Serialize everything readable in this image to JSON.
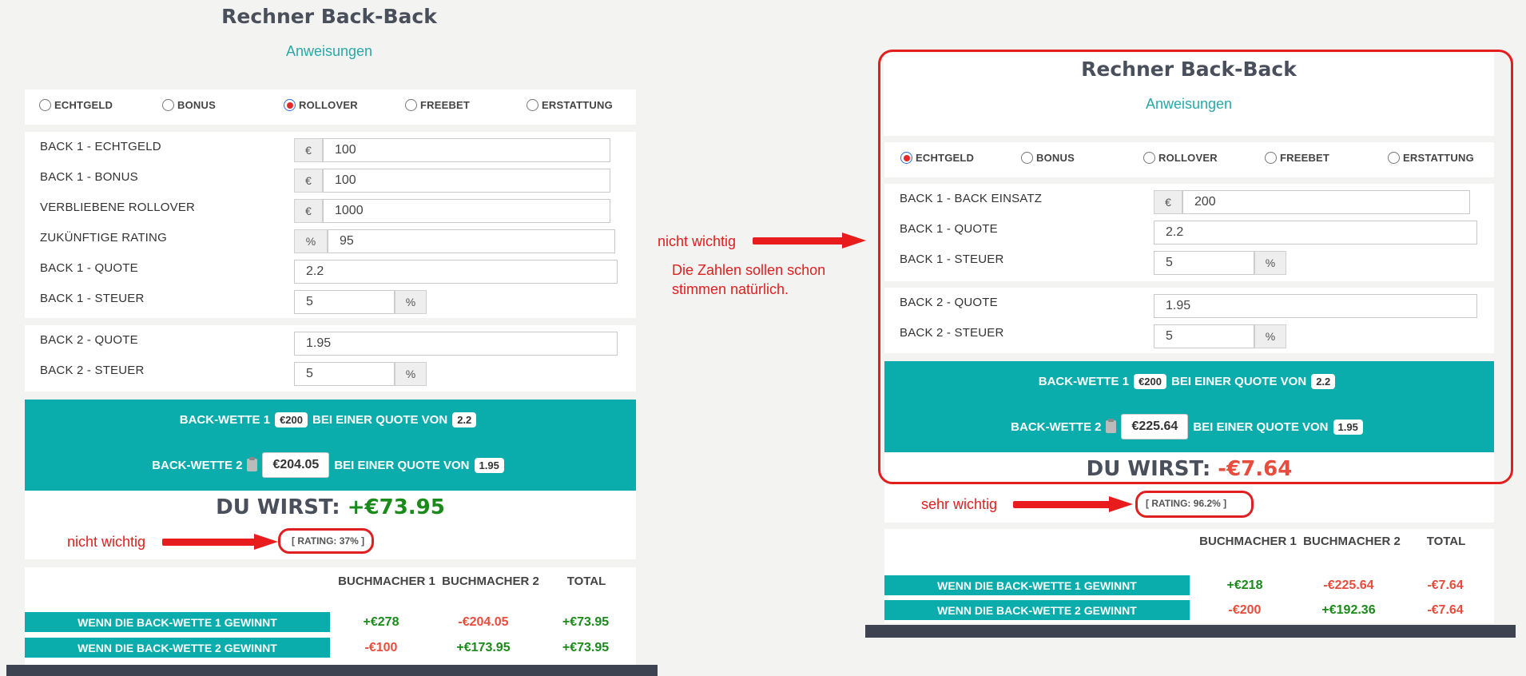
{
  "left": {
    "title": "Rechner Back-Back",
    "instructions_link": "Anweisungen",
    "radios": [
      {
        "label": "ECHTGELD",
        "checked": false
      },
      {
        "label": "BONUS",
        "checked": false
      },
      {
        "label": "ROLLOVER",
        "checked": true
      },
      {
        "label": "FREEBET",
        "checked": false
      },
      {
        "label": "ERSTATTUNG",
        "checked": false
      }
    ],
    "fields1": [
      {
        "label": "BACK 1 - ECHTGELD",
        "prefix": "€",
        "value": "100"
      },
      {
        "label": "BACK 1 - BONUS",
        "prefix": "€",
        "value": "100"
      },
      {
        "label": "VERBLIEBENE ROLLOVER",
        "prefix": "€",
        "value": "1000"
      },
      {
        "label": "ZUKÜNFTIGE RATING",
        "prefix": "%",
        "value": "95"
      },
      {
        "label": "BACK 1 - QUOTE",
        "value": "2.2"
      },
      {
        "label": "BACK 1 - STEUER",
        "value": "5",
        "suffix": "%"
      }
    ],
    "fields2": [
      {
        "label": "BACK 2 - QUOTE",
        "value": "1.95"
      },
      {
        "label": "BACK 2 - STEUER",
        "value": "5",
        "suffix": "%"
      }
    ],
    "bet1": {
      "prefix": "BACK-WETTE 1",
      "amount": "€200",
      "mid": "BEI EINER QUOTE VON",
      "odds": "2.2"
    },
    "bet2": {
      "prefix": "BACK-WETTE 2",
      "amount": "€204.05",
      "mid": "BEI EINER QUOTE VON",
      "odds": "1.95"
    },
    "result_label": "DU WIRST:",
    "result_value": "+€73.95",
    "rating": "[ RATING: 37% ]",
    "annotation": "nicht wichtig",
    "table": {
      "headers": [
        "BUCHMACHER 1",
        "BUCHMACHER 2",
        "TOTAL"
      ],
      "rows": [
        {
          "label": "WENN DIE BACK-WETTE 1 GEWINNT",
          "values": [
            "+€278",
            "-€204.05",
            "+€73.95"
          ]
        },
        {
          "label": "WENN DIE BACK-WETTE 2 GEWINNT",
          "values": [
            "-€100",
            "+€173.95",
            "+€73.95"
          ]
        }
      ]
    }
  },
  "middle": {
    "annotation": "nicht wichtig",
    "note_line1": "Die Zahlen sollen schon",
    "note_line2": "stimmen natürlich."
  },
  "right": {
    "title": "Rechner Back-Back",
    "instructions_link": "Anweisungen",
    "radios": [
      {
        "label": "ECHTGELD",
        "checked": true
      },
      {
        "label": "BONUS",
        "checked": false
      },
      {
        "label": "ROLLOVER",
        "checked": false
      },
      {
        "label": "FREEBET",
        "checked": false
      },
      {
        "label": "ERSTATTUNG",
        "checked": false
      }
    ],
    "fields1": [
      {
        "label": "BACK 1 - BACK EINSATZ",
        "prefix": "€",
        "value": "200"
      },
      {
        "label": "BACK 1 - QUOTE",
        "value": "2.2"
      },
      {
        "label": "BACK 1 - STEUER",
        "value": "5",
        "suffix": "%"
      }
    ],
    "fields2": [
      {
        "label": "BACK 2 - QUOTE",
        "value": "1.95"
      },
      {
        "label": "BACK 2 - STEUER",
        "value": "5",
        "suffix": "%"
      }
    ],
    "bet1": {
      "prefix": "BACK-WETTE 1",
      "amount": "€200",
      "mid": "BEI EINER QUOTE VON",
      "odds": "2.2"
    },
    "bet2": {
      "prefix": "BACK-WETTE 2",
      "amount": "€225.64",
      "mid": "BEI EINER QUOTE VON",
      "odds": "1.95"
    },
    "result_label": "DU WIRST:",
    "result_value": "-€7.64",
    "rating": "[ RATING: 96.2% ]",
    "annotation": "sehr wichtig",
    "table": {
      "headers": [
        "BUCHMACHER 1",
        "BUCHMACHER 2",
        "TOTAL"
      ],
      "rows": [
        {
          "label": "WENN DIE BACK-WETTE 1 GEWINNT",
          "values": [
            "+€218",
            "-€225.64",
            "-€7.64"
          ]
        },
        {
          "label": "WENN DIE BACK-WETTE 2 GEWINNT",
          "values": [
            "-€200",
            "+€192.36",
            "-€7.64"
          ]
        }
      ]
    }
  },
  "colors": {
    "teal": "#0aadab",
    "annotation_red": "#e02020",
    "positive": "#1a8a1a",
    "negative": "#e84c3d"
  }
}
